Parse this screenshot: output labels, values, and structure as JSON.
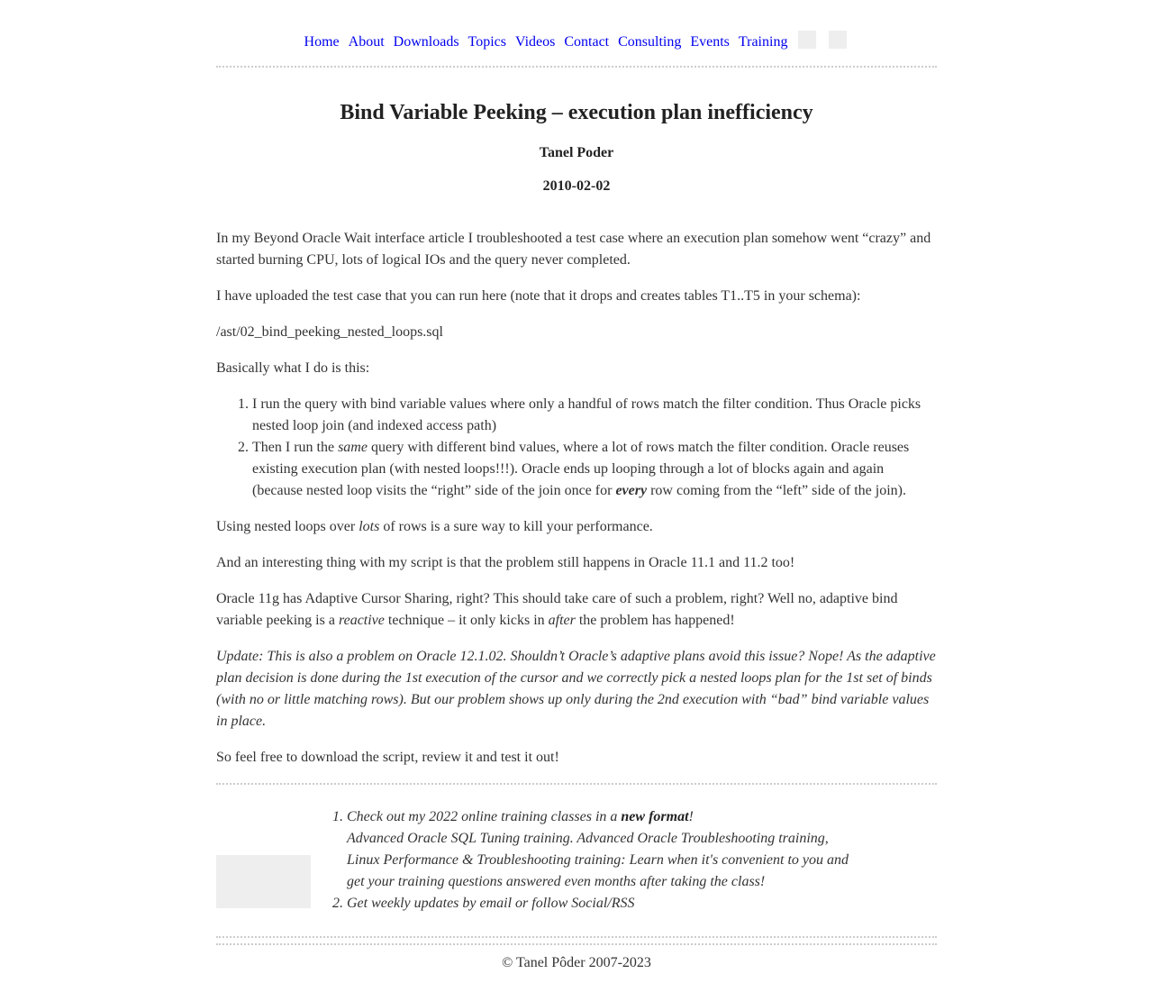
{
  "nav": {
    "items": [
      "Home",
      "About",
      "Downloads",
      "Topics",
      "Videos",
      "Contact",
      "Consulting",
      "Events",
      "Training"
    ]
  },
  "article": {
    "title": "Bind Variable Peeking – execution plan inefficiency",
    "author": "Tanel Poder",
    "date": "2010-02-02",
    "p1": "In my Beyond Oracle Wait interface article I troubleshooted a test case where an execution plan somehow went “crazy” and started burning CPU, lots of logical IOs and the query never completed.",
    "p2": "I have uploaded the test case that you can run here (note that it drops and creates tables T1..T5 in your schema):",
    "p3": "/ast/02_bind_peeking_nested_loops.sql",
    "p4": "Basically what I do is this:",
    "li1": "I run the query with bind variable values where only a handful of rows match the filter condition. Thus Oracle picks nested loop join (and indexed access path)",
    "li2_a": "Then I run the ",
    "li2_em": "same",
    "li2_b": " query with different bind values, where a lot of rows match the filter condition. Oracle reuses existing execution plan (with nested loops!!!). Oracle ends up looping through a lot of blocks again and again (because nested loop visits the “right” side of the join once for ",
    "li2_strong": "every",
    "li2_c": " row coming from the “left” side of the join).",
    "p5_a": "Using nested loops over ",
    "p5_em": "lots",
    "p5_b": " of rows is a sure way to kill your performance.",
    "p6": "And an interesting thing with my script is that the problem still happens in Oracle 11.1 and 11.2 too!",
    "p7_a": "Oracle 11g has Adaptive Cursor Sharing, right? This should take care of such a problem, right? Well no, adaptive bind variable peeking is a ",
    "p7_em1": "reactive",
    "p7_b": " technique – it only kicks in ",
    "p7_em2": "after",
    "p7_c": " the problem has happened!",
    "update": "Update: This is also a problem on Oracle 12.1.02. Shouldn’t Oracle’s adaptive plans avoid this issue? Nope! As the adaptive plan decision is done during the 1st execution of the cursor and we correctly pick a nested loops plan for the 1st set of binds (with no or little matching rows). But our problem shows up only during the 2nd execution with “bad” bind variable values in place.",
    "p8": "So feel free to download the script, review it and test it out!"
  },
  "promo": {
    "item1_a": "Check out my 2022 online training classes in a ",
    "item1_link": "new format",
    "item1_b": "!",
    "item1_line2": "Advanced Oracle SQL Tuning training. Advanced Oracle Troubleshooting training, Linux Performance & Troubleshooting training: Learn when it's convenient to you and get your training questions answered even months after taking the class!",
    "item2": "Get weekly updates by email or follow Social/RSS"
  },
  "footer": {
    "copyright": "© Tanel Pôder 2007-2023"
  }
}
